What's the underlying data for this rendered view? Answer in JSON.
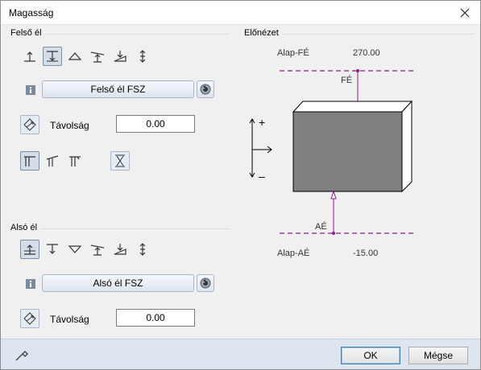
{
  "window": {
    "title": "Magasság"
  },
  "upper": {
    "group_label": "Felső él",
    "button_label": "Felső él FSZ",
    "distance_label": "Távolság",
    "distance_value": "0.00"
  },
  "lower": {
    "group_label": "Alsó él",
    "button_label": "Alsó él FSZ",
    "distance_label": "Távolság",
    "distance_value": "0.00"
  },
  "preview": {
    "group_label": "Előnézet",
    "top_ref_label": "Alap-FÉ",
    "top_ref_value": "270.00",
    "top_marker": "FÉ",
    "bottom_ref_label": "Alap-AÉ",
    "bottom_ref_value": "-15.00",
    "bottom_marker": "AÉ",
    "plus": "+",
    "minus": "–"
  },
  "footer": {
    "ok_label": "OK",
    "cancel_label": "Mégse"
  },
  "colors": {
    "accent_line": "#8b1c8b",
    "box_fill": "#808080",
    "footer_bg": "#dde5ef"
  }
}
